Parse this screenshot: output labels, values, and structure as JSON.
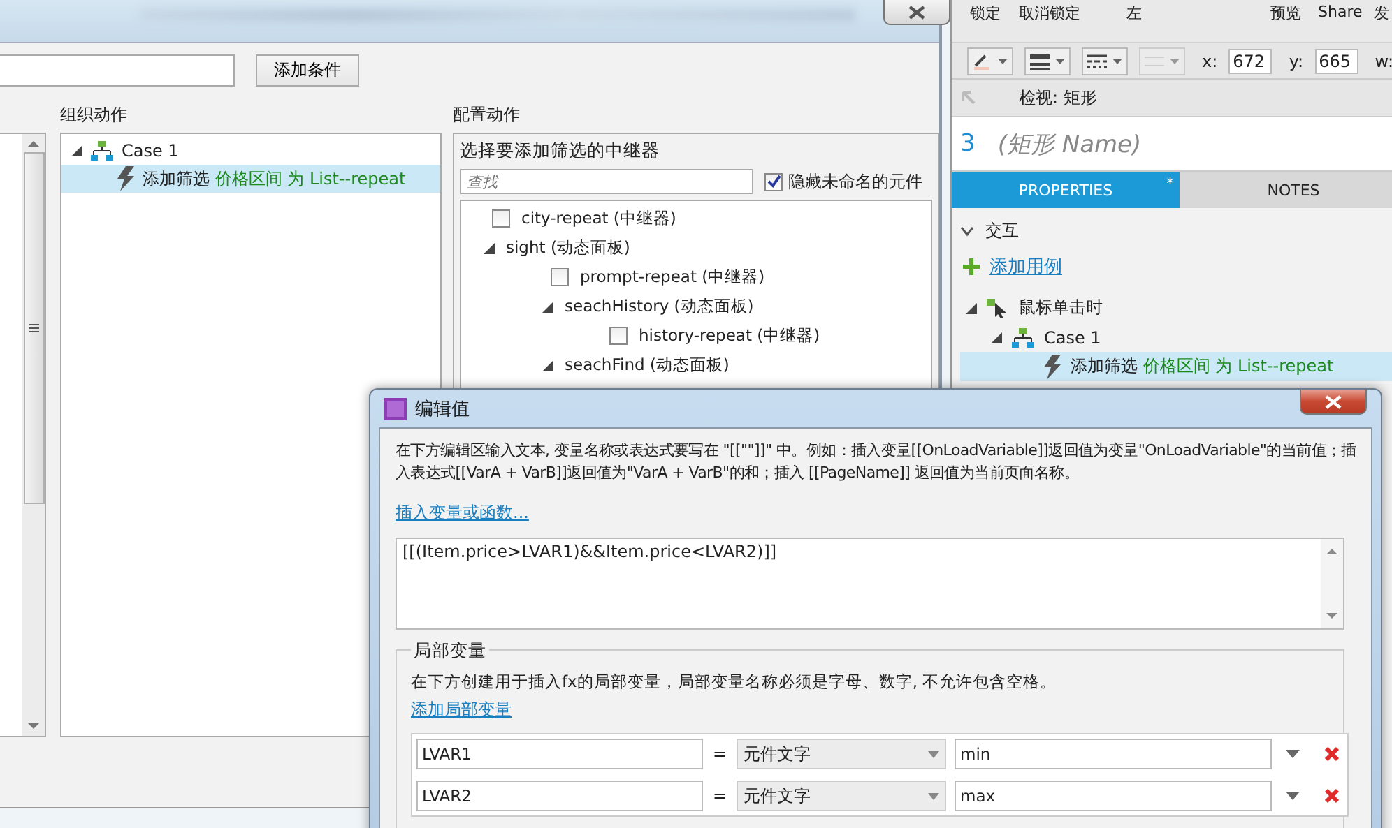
{
  "back_dialog": {
    "add_condition_button": "添加条件",
    "organize_label": "组织动作",
    "configure_label": "配置动作",
    "actions_tree": [
      {
        "label": "Case 1",
        "expanded": true,
        "children": [
          {
            "action": "添加筛选",
            "detail": "价格区间 为 List--repeat",
            "selected": true
          }
        ]
      }
    ],
    "config": {
      "title": "选择要添加筛选的中继器",
      "search": {
        "placeholder": "查找"
      },
      "hide_unnamed": {
        "label": "隐藏未命名的元件",
        "checked": true
      },
      "tree": [
        {
          "kind": "checkbox",
          "label": "city-repeat (中继器)",
          "checked": false
        },
        {
          "kind": "folder",
          "label": "sight (动态面板)",
          "expanded": true,
          "children": [
            {
              "kind": "checkbox",
              "label": "prompt-repeat (中继器)",
              "checked": false
            },
            {
              "kind": "folder",
              "label": "seachHistory (动态面板)",
              "expanded": true,
              "children": [
                {
                  "kind": "checkbox",
                  "label": "history-repeat (中继器)",
                  "checked": false
                }
              ]
            },
            {
              "kind": "folder",
              "label": "seachFind (动态面板)",
              "expanded": true
            }
          ]
        }
      ]
    }
  },
  "right_panel": {
    "toolbar": [
      "锁定",
      "取消锁定",
      "左",
      "预览",
      "Share",
      "发"
    ],
    "coords": [
      {
        "label": "x:",
        "value": "672"
      },
      {
        "label": "y:",
        "value": "665"
      },
      {
        "label": "w:"
      }
    ],
    "inspector_title": "检视: 矩形",
    "shape_number": "3",
    "shape_name_placeholder": "(矩形 Name)",
    "tabs": [
      {
        "label": "PROPERTIES",
        "selected": true,
        "mark": "*"
      },
      {
        "label": "NOTES",
        "selected": false
      }
    ],
    "section": {
      "label": "交互",
      "expanded": true
    },
    "add_case_link": "添加用例",
    "interactions": [
      {
        "kind": "event",
        "label": "鼠标单击时",
        "expanded": true,
        "children": [
          {
            "kind": "case",
            "label": "Case 1",
            "expanded": true,
            "children": [
              {
                "kind": "action",
                "action": "添加筛选",
                "detail": "价格区间 为 List--repeat",
                "selected": true
              }
            ]
          }
        ]
      }
    ]
  },
  "edit_dialog": {
    "title": "编辑值",
    "description": "在下方编辑区输入文本, 变量名称或表达式要写在 \"[[\"\"]]\" 中。例如：插入变量[[OnLoadVariable]]返回值为变量\"OnLoadVariable\"的当前值；插入表达式[[VarA + VarB]]返回值为\"VarA + VarB\"的和；插入 [[PageName]] 返回值为当前页面名称。",
    "insert_link": "插入变量或函数...",
    "expression": "[[(Item.price>LVAR1)&&Item.price<LVAR2)]]",
    "local_vars": {
      "legend": "局部变量",
      "description": "在下方创建用于插入fx的局部变量，局部变量名称必须是字母、数字, 不允许包含空格。",
      "add_link": "添加局部变量",
      "rows": [
        {
          "name": "LVAR1",
          "equals": "=",
          "type": "元件文字",
          "value": "min"
        },
        {
          "name": "LVAR2",
          "equals": "=",
          "type": "元件文字",
          "value": "max"
        }
      ]
    }
  }
}
